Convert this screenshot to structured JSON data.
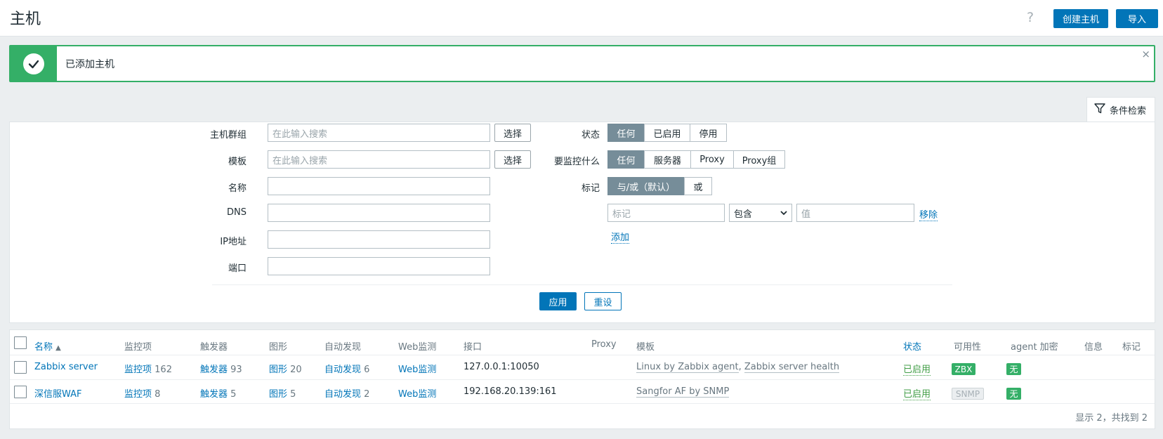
{
  "header": {
    "title": "主机",
    "help_icon": "?",
    "create_label": "创建主机",
    "import_label": "导入"
  },
  "message": {
    "text": "已添加主机",
    "close_icon": "×"
  },
  "filter": {
    "tab_label": "条件检索",
    "host_groups": {
      "label": "主机群组",
      "placeholder": "在此输入搜索",
      "select_label": "选择"
    },
    "templates": {
      "label": "模板",
      "placeholder": "在此输入搜索",
      "select_label": "选择"
    },
    "name_label": "名称",
    "dns_label": "DNS",
    "ip_label": "IP地址",
    "port_label": "端口",
    "status": {
      "label": "状态",
      "options": [
        "任何",
        "已启用",
        "停用"
      ],
      "selected": "任何"
    },
    "monitored_by": {
      "label": "要监控什么",
      "options": [
        "任何",
        "服务器",
        "Proxy",
        "Proxy组"
      ],
      "selected": "任何"
    },
    "tags": {
      "label": "标记",
      "options": [
        "与/或（默认）",
        "或"
      ],
      "selected": "与/或（默认）",
      "tag_placeholder": "标记",
      "operator": "包含",
      "value_placeholder": "值",
      "remove_label": "移除",
      "add_label": "添加"
    },
    "apply_label": "应用",
    "reset_label": "重设"
  },
  "table": {
    "headers": {
      "name": "名称",
      "sort_indicator": "▲",
      "items": "监控项",
      "triggers": "触发器",
      "graphs": "图形",
      "discovery": "自动发现",
      "web": "Web监测",
      "interface": "接口",
      "proxy": "Proxy",
      "templates": "模板",
      "status": "状态",
      "availability": "可用性",
      "encryption": "agent 加密",
      "info": "信息",
      "tags": "标记"
    },
    "rows": [
      {
        "name": "Zabbix server",
        "items_label": "监控项",
        "items_count": "162",
        "triggers_label": "触发器",
        "triggers_count": "93",
        "graphs_label": "图形",
        "graphs_count": "20",
        "discovery_label": "自动发现",
        "discovery_count": "6",
        "web": "Web监测",
        "interface": "127.0.0.1:10050",
        "template_1": "Linux by Zabbix agent",
        "template_sep": ", ",
        "template_2": "Zabbix server health",
        "status": "已启用",
        "availability": "ZBX",
        "encryption": "无"
      },
      {
        "name": "深信服WAF",
        "items_label": "监控项",
        "items_count": "8",
        "triggers_label": "触发器",
        "triggers_count": "5",
        "graphs_label": "图形",
        "graphs_count": "5",
        "discovery_label": "自动发现",
        "discovery_count": "2",
        "web": "Web监测",
        "interface": "192.168.20.139:161",
        "template_1": "Sangfor AF by SNMP",
        "status": "已启用",
        "availability": "SNMP",
        "encryption": "无"
      }
    ],
    "footer": "显示 2，共找到 2"
  },
  "colors": {
    "accent": "#0275b8",
    "success": "#34af67",
    "segment_active": "#768d99"
  }
}
